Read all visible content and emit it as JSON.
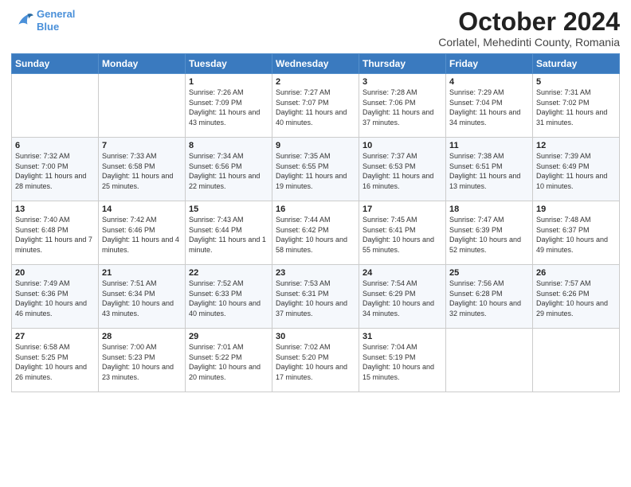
{
  "logo": {
    "line1": "General",
    "line2": "Blue"
  },
  "title": "October 2024",
  "subtitle": "Corlatel, Mehedinti County, Romania",
  "header_days": [
    "Sunday",
    "Monday",
    "Tuesday",
    "Wednesday",
    "Thursday",
    "Friday",
    "Saturday"
  ],
  "weeks": [
    [
      {
        "day": "",
        "content": ""
      },
      {
        "day": "",
        "content": ""
      },
      {
        "day": "1",
        "content": "Sunrise: 7:26 AM\nSunset: 7:09 PM\nDaylight: 11 hours and 43 minutes."
      },
      {
        "day": "2",
        "content": "Sunrise: 7:27 AM\nSunset: 7:07 PM\nDaylight: 11 hours and 40 minutes."
      },
      {
        "day": "3",
        "content": "Sunrise: 7:28 AM\nSunset: 7:06 PM\nDaylight: 11 hours and 37 minutes."
      },
      {
        "day": "4",
        "content": "Sunrise: 7:29 AM\nSunset: 7:04 PM\nDaylight: 11 hours and 34 minutes."
      },
      {
        "day": "5",
        "content": "Sunrise: 7:31 AM\nSunset: 7:02 PM\nDaylight: 11 hours and 31 minutes."
      }
    ],
    [
      {
        "day": "6",
        "content": "Sunrise: 7:32 AM\nSunset: 7:00 PM\nDaylight: 11 hours and 28 minutes."
      },
      {
        "day": "7",
        "content": "Sunrise: 7:33 AM\nSunset: 6:58 PM\nDaylight: 11 hours and 25 minutes."
      },
      {
        "day": "8",
        "content": "Sunrise: 7:34 AM\nSunset: 6:56 PM\nDaylight: 11 hours and 22 minutes."
      },
      {
        "day": "9",
        "content": "Sunrise: 7:35 AM\nSunset: 6:55 PM\nDaylight: 11 hours and 19 minutes."
      },
      {
        "day": "10",
        "content": "Sunrise: 7:37 AM\nSunset: 6:53 PM\nDaylight: 11 hours and 16 minutes."
      },
      {
        "day": "11",
        "content": "Sunrise: 7:38 AM\nSunset: 6:51 PM\nDaylight: 11 hours and 13 minutes."
      },
      {
        "day": "12",
        "content": "Sunrise: 7:39 AM\nSunset: 6:49 PM\nDaylight: 11 hours and 10 minutes."
      }
    ],
    [
      {
        "day": "13",
        "content": "Sunrise: 7:40 AM\nSunset: 6:48 PM\nDaylight: 11 hours and 7 minutes."
      },
      {
        "day": "14",
        "content": "Sunrise: 7:42 AM\nSunset: 6:46 PM\nDaylight: 11 hours and 4 minutes."
      },
      {
        "day": "15",
        "content": "Sunrise: 7:43 AM\nSunset: 6:44 PM\nDaylight: 11 hours and 1 minute."
      },
      {
        "day": "16",
        "content": "Sunrise: 7:44 AM\nSunset: 6:42 PM\nDaylight: 10 hours and 58 minutes."
      },
      {
        "day": "17",
        "content": "Sunrise: 7:45 AM\nSunset: 6:41 PM\nDaylight: 10 hours and 55 minutes."
      },
      {
        "day": "18",
        "content": "Sunrise: 7:47 AM\nSunset: 6:39 PM\nDaylight: 10 hours and 52 minutes."
      },
      {
        "day": "19",
        "content": "Sunrise: 7:48 AM\nSunset: 6:37 PM\nDaylight: 10 hours and 49 minutes."
      }
    ],
    [
      {
        "day": "20",
        "content": "Sunrise: 7:49 AM\nSunset: 6:36 PM\nDaylight: 10 hours and 46 minutes."
      },
      {
        "day": "21",
        "content": "Sunrise: 7:51 AM\nSunset: 6:34 PM\nDaylight: 10 hours and 43 minutes."
      },
      {
        "day": "22",
        "content": "Sunrise: 7:52 AM\nSunset: 6:33 PM\nDaylight: 10 hours and 40 minutes."
      },
      {
        "day": "23",
        "content": "Sunrise: 7:53 AM\nSunset: 6:31 PM\nDaylight: 10 hours and 37 minutes."
      },
      {
        "day": "24",
        "content": "Sunrise: 7:54 AM\nSunset: 6:29 PM\nDaylight: 10 hours and 34 minutes."
      },
      {
        "day": "25",
        "content": "Sunrise: 7:56 AM\nSunset: 6:28 PM\nDaylight: 10 hours and 32 minutes."
      },
      {
        "day": "26",
        "content": "Sunrise: 7:57 AM\nSunset: 6:26 PM\nDaylight: 10 hours and 29 minutes."
      }
    ],
    [
      {
        "day": "27",
        "content": "Sunrise: 6:58 AM\nSunset: 5:25 PM\nDaylight: 10 hours and 26 minutes."
      },
      {
        "day": "28",
        "content": "Sunrise: 7:00 AM\nSunset: 5:23 PM\nDaylight: 10 hours and 23 minutes."
      },
      {
        "day": "29",
        "content": "Sunrise: 7:01 AM\nSunset: 5:22 PM\nDaylight: 10 hours and 20 minutes."
      },
      {
        "day": "30",
        "content": "Sunrise: 7:02 AM\nSunset: 5:20 PM\nDaylight: 10 hours and 17 minutes."
      },
      {
        "day": "31",
        "content": "Sunrise: 7:04 AM\nSunset: 5:19 PM\nDaylight: 10 hours and 15 minutes."
      },
      {
        "day": "",
        "content": ""
      },
      {
        "day": "",
        "content": ""
      }
    ]
  ]
}
